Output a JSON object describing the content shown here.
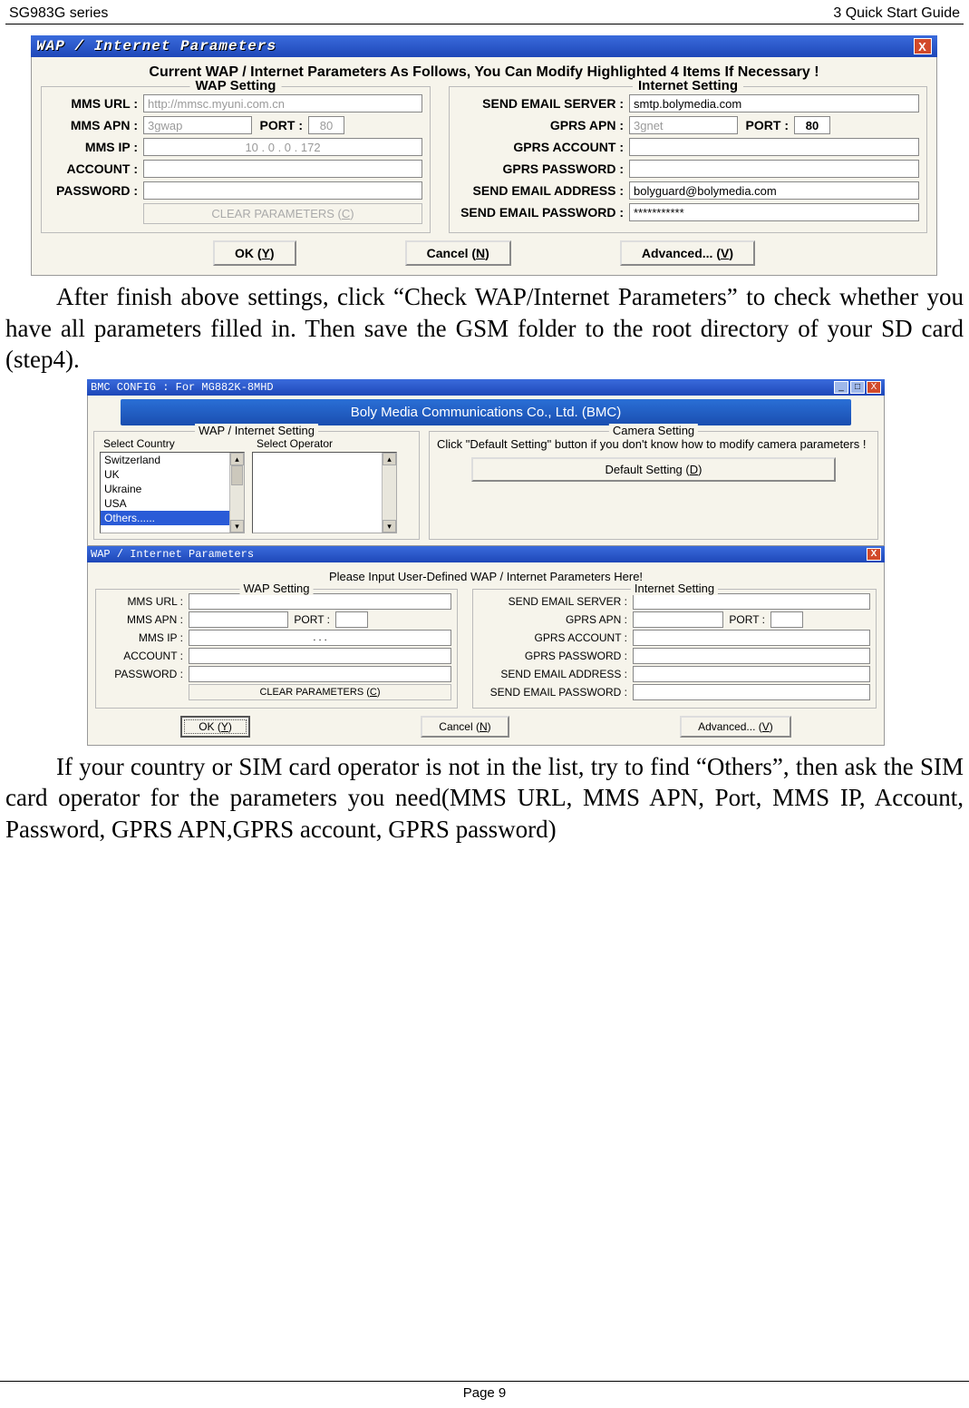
{
  "header": {
    "left": "SG983G series",
    "right": "3 Quick Start Guide"
  },
  "footer": "Page 9",
  "para1": "After finish above settings, click “Check WAP/Internet Parameters” to check whether you have all parameters filled in. Then save the GSM folder to the root directory of your SD card (step4).",
  "para2": "If your country or SIM card operator is not in the list, try to find “Others”, then ask the SIM card operator for the parameters you need(MMS URL, MMS APN, Port, MMS IP, Account, Password, GPRS APN,GPRS account, GPRS password)",
  "dlg1": {
    "title": "WAP / Internet Parameters",
    "heading": "Current WAP / Internet Parameters As Follows, You Can Modify Highlighted 4 Items If Necessary !",
    "wap_title": "WAP Setting",
    "inet_title": "Internet Setting",
    "wap": {
      "mms_url_lbl": "MMS URL :",
      "mms_url_val": "http://mmsc.myuni.com.cn",
      "mms_apn_lbl": "MMS APN :",
      "mms_apn_val": "3gwap",
      "port_lbl": "PORT :",
      "port_val": "80",
      "mms_ip_lbl": "MMS IP :",
      "mms_ip_val": "10   .   0   .   0   .   172",
      "account_lbl": "ACCOUNT :",
      "account_val": "",
      "password_lbl": "PASSWORD :",
      "password_val": "",
      "clear_btn": "CLEAR PARAMETERS (C)"
    },
    "inet": {
      "send_server_lbl": "SEND EMAIL SERVER :",
      "send_server_val": "smtp.bolymedia.com",
      "gprs_apn_lbl": "GPRS APN :",
      "gprs_apn_val": "3gnet",
      "port_lbl": "PORT :",
      "port_val": "80",
      "gprs_acct_lbl": "GPRS ACCOUNT :",
      "gprs_acct_val": "",
      "gprs_pwd_lbl": "GPRS PASSWORD :",
      "gprs_pwd_val": "",
      "send_addr_lbl": "SEND EMAIL ADDRESS :",
      "send_addr_val": "bolyguard@bolymedia.com",
      "send_pwd_lbl": "SEND EMAIL PASSWORD :",
      "send_pwd_val": "***********"
    },
    "buttons": {
      "ok": "OK (Y)",
      "cancel": "Cancel (N)",
      "adv": "Advanced... (V)"
    }
  },
  "dlg2": {
    "config_title": "BMC CONFIG : For MG882K-8MHD",
    "banner": "Boly Media Communications Co., Ltd. (BMC)",
    "wapinet_title": "WAP / Internet Setting",
    "cam_title": "Camera Setting",
    "sel_country": "Select Country",
    "sel_operator": "Select Operator",
    "countries": [
      "Switzerland",
      "UK",
      "Ukraine",
      "USA",
      "Others......"
    ],
    "cam_hint": "Click \"Default Setting\" button if you don't know how to modify camera parameters !",
    "default_btn": "Default Setting (D)",
    "params_title": "WAP / Internet Parameters",
    "params_heading": "Please Input User-Defined WAP / Internet Parameters Here!",
    "wap_title": "WAP Setting",
    "inet_title": "Internet Setting",
    "wap": {
      "mms_url_lbl": "MMS URL :",
      "mms_apn_lbl": "MMS APN :",
      "port_lbl": "PORT :",
      "mms_ip_lbl": "MMS IP :",
      "mms_ip_val": ".          .          .",
      "account_lbl": "ACCOUNT :",
      "password_lbl": "PASSWORD :",
      "clear_btn": "CLEAR PARAMETERS (C)"
    },
    "inet": {
      "send_server_lbl": "SEND EMAIL SERVER :",
      "gprs_apn_lbl": "GPRS APN :",
      "port_lbl": "PORT :",
      "gprs_acct_lbl": "GPRS ACCOUNT :",
      "gprs_pwd_lbl": "GPRS PASSWORD :",
      "send_addr_lbl": "SEND EMAIL ADDRESS :",
      "send_pwd_lbl": "SEND EMAIL PASSWORD :"
    },
    "buttons": {
      "ok": "OK (Y)",
      "cancel": "Cancel (N)",
      "adv": "Advanced... (V)"
    }
  }
}
